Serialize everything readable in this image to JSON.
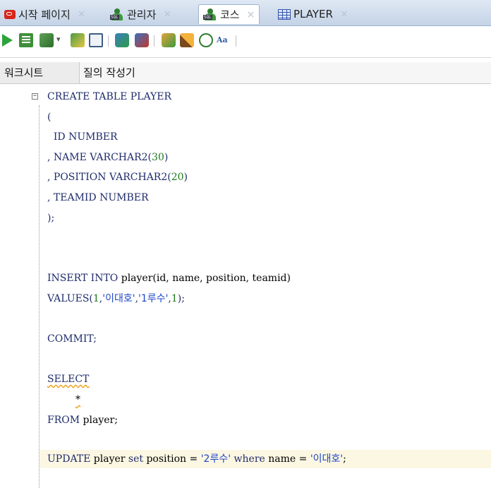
{
  "tabs": [
    {
      "label": "시작 페이지",
      "icon": "oracle-icon",
      "close": "×"
    },
    {
      "label": "관리자",
      "icon": "sql-user-icon",
      "close": "×"
    },
    {
      "label": "코스",
      "icon": "sql-user-icon",
      "close": "×",
      "active": true
    },
    {
      "label": "PLAYER",
      "icon": "table-icon",
      "close": "×"
    }
  ],
  "toolbar": {
    "drop_glyph": "▾",
    "format_label": "Aa"
  },
  "subtabs": {
    "worksheet": "워크시트",
    "query_builder": "질의 작성기"
  },
  "editor": {
    "fold_marker": "−",
    "lines": [
      "CREATE TABLE PLAYER",
      "(",
      "  ID NUMBER",
      ", NAME VARCHAR2(",
      "30",
      ")",
      ", POSITION VARCHAR2(",
      "20",
      ")",
      ", TEAMID NUMBER",
      ");",
      "INSERT INTO ",
      "player(id, name, position, teamid)",
      "VALUES(",
      "1",
      ",",
      "'이대호'",
      ",",
      "'1루수'",
      ",",
      "1",
      ");",
      "COMMIT;",
      "SELECT",
      "*",
      "FROM ",
      "player;",
      "UPDATE ",
      "player ",
      "set ",
      "position = ",
      "'2루수'",
      " where ",
      "name = ",
      "'이대호'",
      ";"
    ]
  }
}
